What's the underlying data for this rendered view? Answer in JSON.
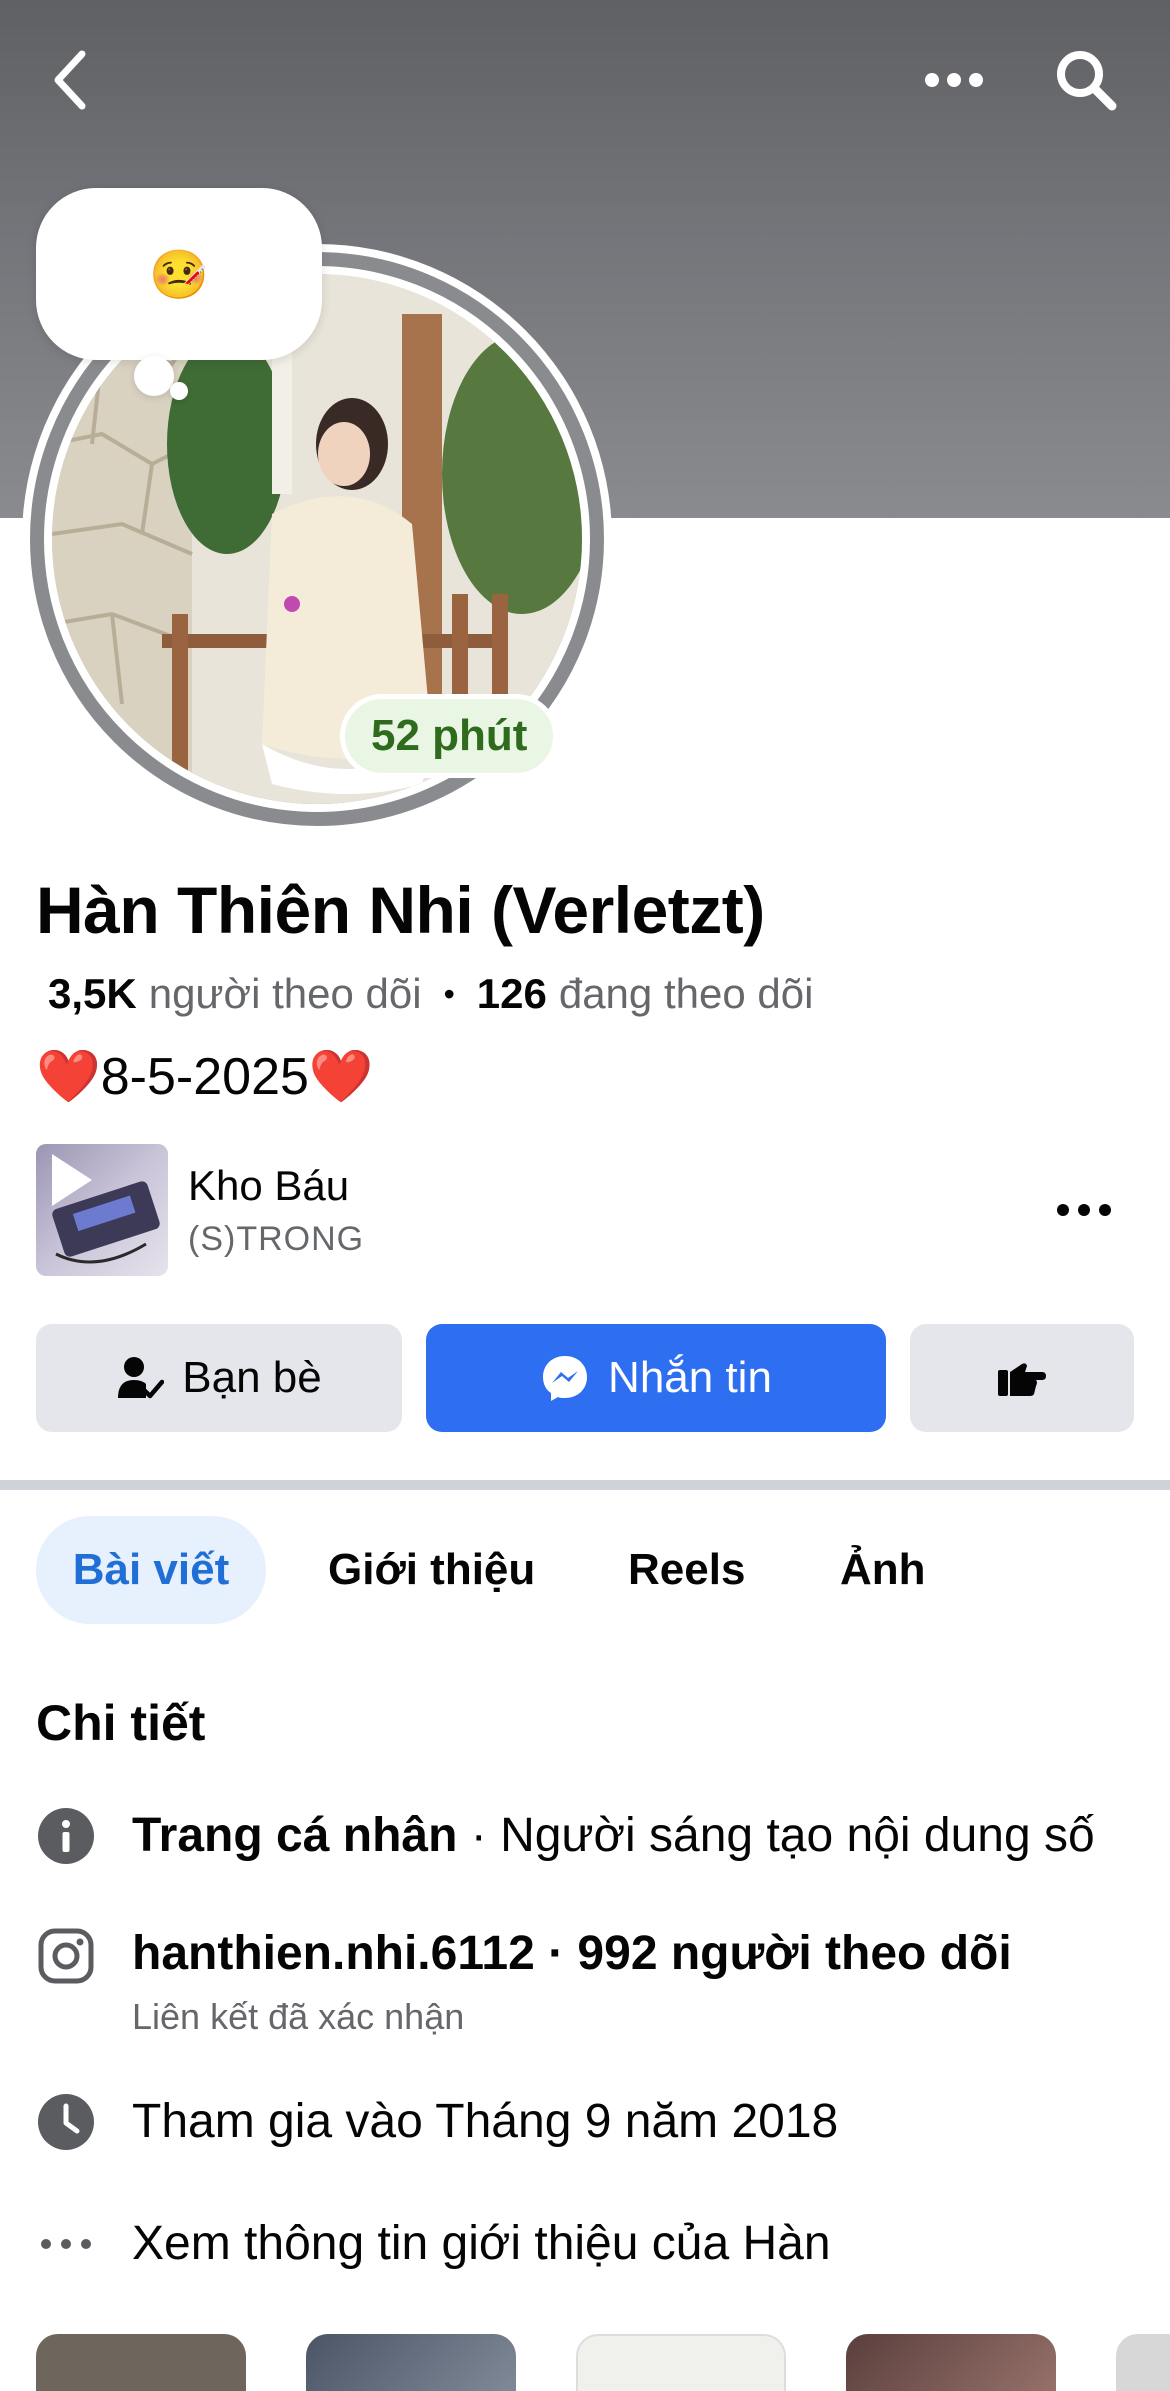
{
  "header": {
    "back_icon": "chevron-left-icon",
    "more_icon": "ellipsis-icon",
    "search_icon": "search-icon"
  },
  "profile": {
    "note_emoji": "🤒",
    "active_status": "52 phút",
    "name": "Hàn Thiên Nhi (Verletzt)",
    "followers_count": "3,5K",
    "followers_label": "người theo dõi",
    "following_count": "126",
    "following_label": "đang theo dõi",
    "bio_heart_left": "❤️",
    "bio_text": "8-5-2025",
    "bio_heart_right": "❤️"
  },
  "music": {
    "title": "Kho Báu",
    "artist": "(S)TRONG"
  },
  "actions": {
    "friends_label": "Bạn bè",
    "message_label": "Nhắn tin"
  },
  "tabs": [
    {
      "label": "Bài viết",
      "active": true
    },
    {
      "label": "Giới thiệu",
      "active": false
    },
    {
      "label": "Reels",
      "active": false
    },
    {
      "label": "Ảnh",
      "active": false
    }
  ],
  "details": {
    "title": "Chi tiết",
    "page_type_bold": "Trang cá nhân",
    "page_type_rest": " · Người sáng tạo nội dung số",
    "instagram": "hanthien.nhi.6112 · 992 người theo dõi",
    "instagram_sub": "Liên kết đã xác nhận",
    "joined": "Tham gia vào Tháng 9 năm 2018",
    "see_more": "Xem thông tin giới thiệu của Hàn"
  },
  "colors": {
    "accent": "#2d6ff0",
    "active_tab_bg": "#e7f0fd",
    "active_badge_text": "#2f6b1d"
  }
}
